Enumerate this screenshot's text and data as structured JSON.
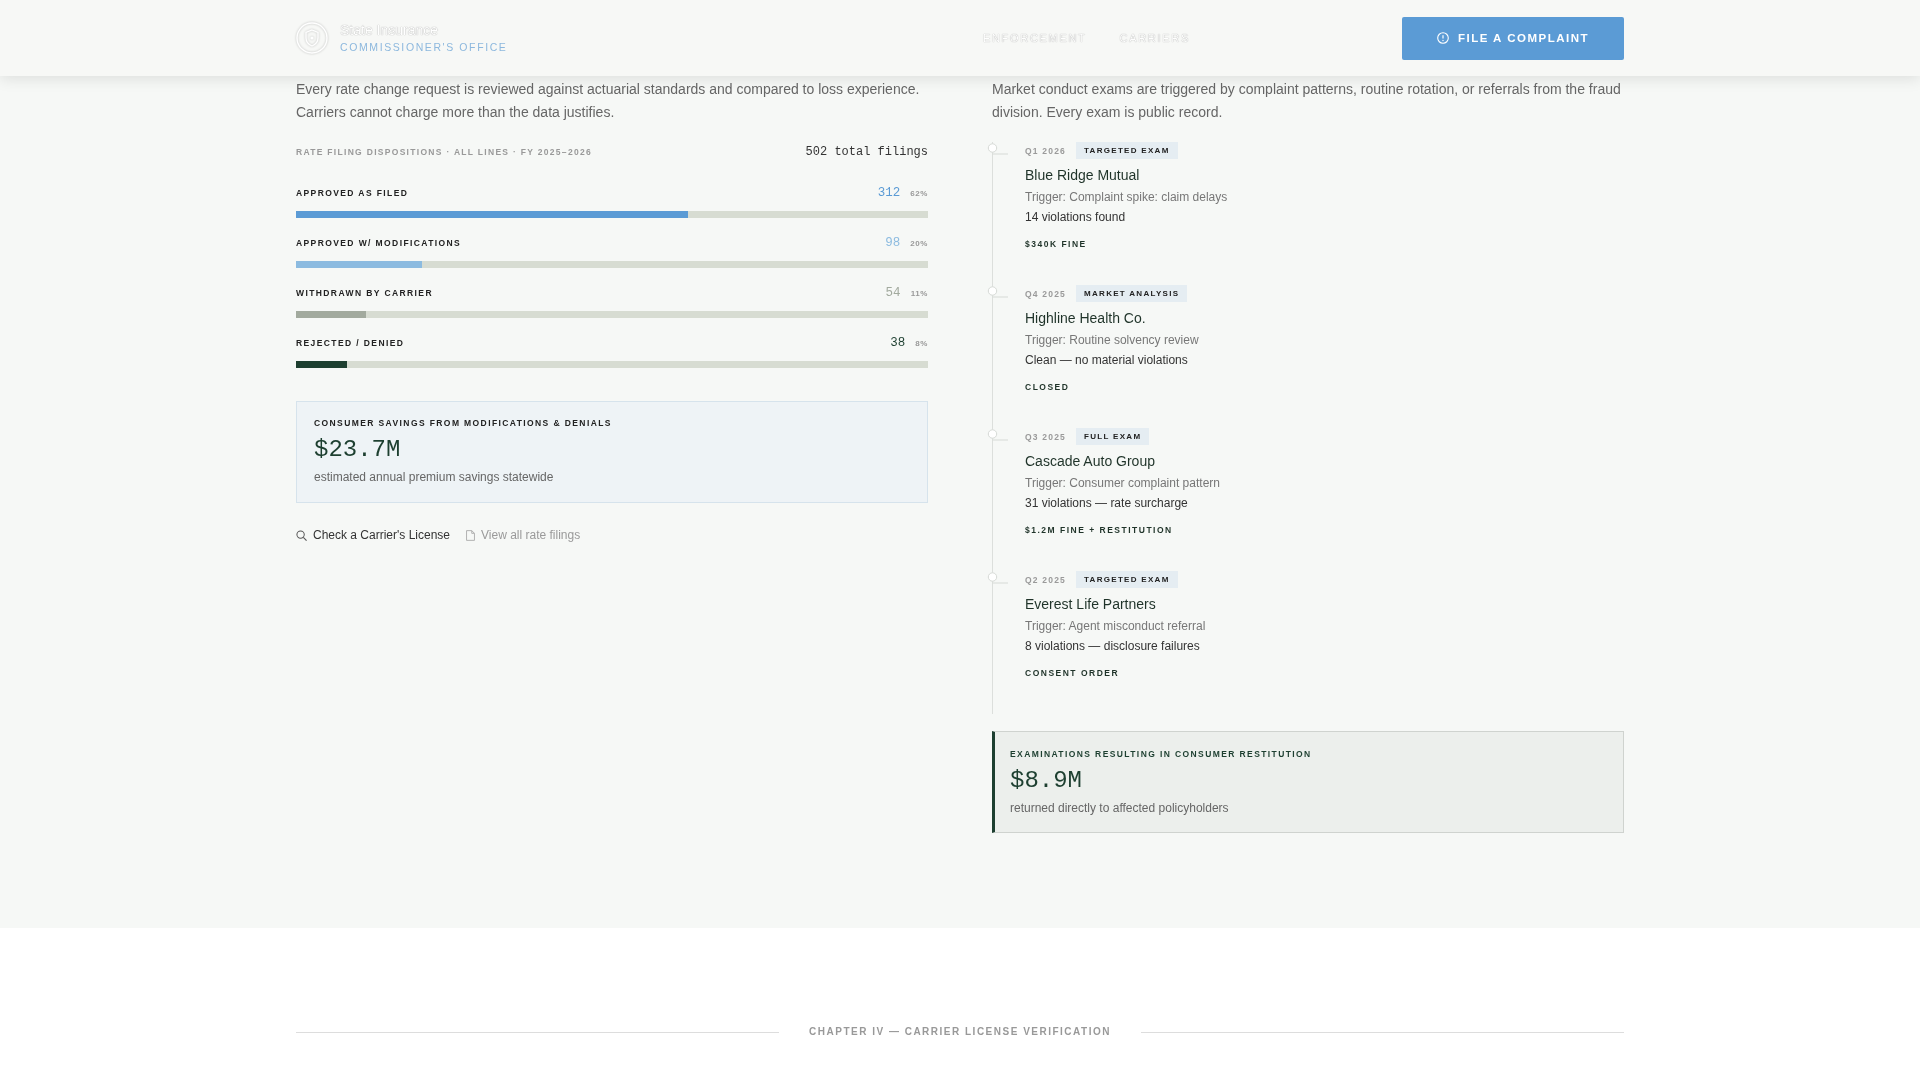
{
  "header": {
    "logo_title": "State Insurance",
    "logo_subtitle": "COMMISSIONER'S OFFICE",
    "nav": [
      {
        "label": "ENFORCEMENT"
      },
      {
        "label": "CARRIERS"
      }
    ],
    "cta": {
      "label": "FILE A COMPLAINT"
    }
  },
  "rate_review": {
    "intro": "Every rate change request is reviewed against actuarial standards and compared to loss experience. Carriers cannot charge more than the data justifies.",
    "chart_title": "RATE FILING DISPOSITIONS · ALL LINES · FY 2025–2026",
    "total": "502 total filings",
    "dispositions": [
      {
        "label": "APPROVED AS FILED",
        "count": "312",
        "percent": "62%",
        "level": 0.62,
        "color": "#5b9bd5"
      },
      {
        "label": "APPROVED W/ MODIFICATIONS",
        "count": "98",
        "percent": "20%",
        "level": 0.2,
        "color": "#8cbbe0"
      },
      {
        "label": "WITHDRAWN BY CARRIER",
        "count": "54",
        "percent": "11%",
        "level": 0.11,
        "color": "#a2aa9e"
      },
      {
        "label": "REJECTED / DENIED",
        "count": "38",
        "percent": "8%",
        "level": 0.08,
        "color": "#1d3f30"
      }
    ],
    "savings": {
      "label": "CONSUMER SAVINGS FROM MODIFICATIONS & DENIALS",
      "value": "$23.7M",
      "note": "estimated annual premium savings statewide"
    },
    "links": [
      {
        "kind": "search",
        "label": "Check a Carrier's License"
      },
      {
        "kind": "document",
        "label": "View all rate filings"
      }
    ]
  },
  "exams": {
    "intro": "Market conduct exams are triggered by complaint patterns, routine rotation, or referrals from the fraud division. Every exam is public record.",
    "timeline": [
      {
        "date": "Q1 2026",
        "tag": "TARGETED EXAM",
        "carrier": "Blue Ridge Mutual",
        "trigger": "Trigger: Complaint spike: claim delays",
        "result": "14 violations found",
        "outcome": "$340K FINE"
      },
      {
        "date": "Q4 2025",
        "tag": "MARKET ANALYSIS",
        "carrier": "Highline Health Co.",
        "trigger": "Trigger: Routine solvency review",
        "result": "Clean — no material violations",
        "outcome": "CLOSED"
      },
      {
        "date": "Q3 2025",
        "tag": "FULL EXAM",
        "carrier": "Cascade Auto Group",
        "trigger": "Trigger: Consumer complaint pattern",
        "result": "31 violations — rate surcharge",
        "outcome": "$1.2M FINE + RESTITUTION"
      },
      {
        "date": "Q2 2025",
        "tag": "TARGETED EXAM",
        "carrier": "Everest Life Partners",
        "trigger": "Trigger: Agent misconduct referral",
        "result": "8 violations — disclosure failures",
        "outcome": "CONSENT ORDER"
      }
    ],
    "restitution": {
      "label": "EXAMINATIONS RESULTING IN CONSUMER RESTITUTION",
      "value": "$8.9M",
      "note": "returned directly to affected policyholders"
    }
  },
  "chapter_divider": {
    "label": "CHAPTER IV — CARRIER LICENSE VERIFICATION"
  }
}
